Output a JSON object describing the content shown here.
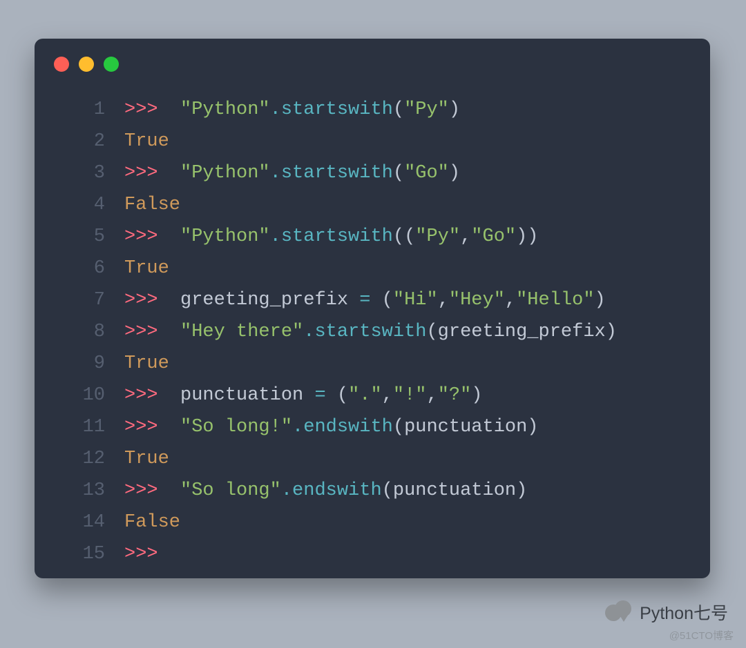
{
  "window": {
    "dots": [
      "red",
      "yellow",
      "green"
    ]
  },
  "code_lines": [
    {
      "n": "1",
      "segments": [
        {
          "cls": "tok-prompt",
          "t": ">>>  "
        },
        {
          "cls": "tok-str",
          "t": "\"Python\""
        },
        {
          "cls": "tok-method",
          "t": ".startswith"
        },
        {
          "cls": "tok-ident",
          "t": "("
        },
        {
          "cls": "tok-str",
          "t": "\"Py\""
        },
        {
          "cls": "tok-ident",
          "t": ")"
        }
      ]
    },
    {
      "n": "2",
      "segments": [
        {
          "cls": "tok-bool",
          "t": "True"
        }
      ]
    },
    {
      "n": "3",
      "segments": [
        {
          "cls": "tok-prompt",
          "t": ">>>  "
        },
        {
          "cls": "tok-str",
          "t": "\"Python\""
        },
        {
          "cls": "tok-method",
          "t": ".startswith"
        },
        {
          "cls": "tok-ident",
          "t": "("
        },
        {
          "cls": "tok-str",
          "t": "\"Go\""
        },
        {
          "cls": "tok-ident",
          "t": ")"
        }
      ]
    },
    {
      "n": "4",
      "segments": [
        {
          "cls": "tok-bool",
          "t": "False"
        }
      ]
    },
    {
      "n": "5",
      "segments": [
        {
          "cls": "tok-prompt",
          "t": ">>>  "
        },
        {
          "cls": "tok-str",
          "t": "\"Python\""
        },
        {
          "cls": "tok-method",
          "t": ".startswith"
        },
        {
          "cls": "tok-ident",
          "t": "(("
        },
        {
          "cls": "tok-str",
          "t": "\"Py\""
        },
        {
          "cls": "tok-ident",
          "t": ","
        },
        {
          "cls": "tok-str",
          "t": "\"Go\""
        },
        {
          "cls": "tok-ident",
          "t": "))"
        }
      ]
    },
    {
      "n": "6",
      "segments": [
        {
          "cls": "tok-bool",
          "t": "True"
        }
      ]
    },
    {
      "n": "7",
      "segments": [
        {
          "cls": "tok-prompt",
          "t": ">>>  "
        },
        {
          "cls": "tok-ident",
          "t": "greeting_prefix "
        },
        {
          "cls": "tok-method",
          "t": "="
        },
        {
          "cls": "tok-ident",
          "t": " ("
        },
        {
          "cls": "tok-str",
          "t": "\"Hi\""
        },
        {
          "cls": "tok-ident",
          "t": ","
        },
        {
          "cls": "tok-str",
          "t": "\"Hey\""
        },
        {
          "cls": "tok-ident",
          "t": ","
        },
        {
          "cls": "tok-str",
          "t": "\"Hello\""
        },
        {
          "cls": "tok-ident",
          "t": ")"
        }
      ]
    },
    {
      "n": "8",
      "segments": [
        {
          "cls": "tok-prompt",
          "t": ">>>  "
        },
        {
          "cls": "tok-str",
          "t": "\"Hey there\""
        },
        {
          "cls": "tok-method",
          "t": ".startswith"
        },
        {
          "cls": "tok-ident",
          "t": "(greeting_prefix)"
        }
      ]
    },
    {
      "n": "9",
      "segments": [
        {
          "cls": "tok-bool",
          "t": "True"
        }
      ]
    },
    {
      "n": "10",
      "segments": [
        {
          "cls": "tok-prompt",
          "t": ">>>  "
        },
        {
          "cls": "tok-ident",
          "t": "punctuation "
        },
        {
          "cls": "tok-method",
          "t": "="
        },
        {
          "cls": "tok-ident",
          "t": " ("
        },
        {
          "cls": "tok-str",
          "t": "\".\""
        },
        {
          "cls": "tok-ident",
          "t": ","
        },
        {
          "cls": "tok-str",
          "t": "\"!\""
        },
        {
          "cls": "tok-ident",
          "t": ","
        },
        {
          "cls": "tok-str",
          "t": "\"?\""
        },
        {
          "cls": "tok-ident",
          "t": ")"
        }
      ]
    },
    {
      "n": "11",
      "segments": [
        {
          "cls": "tok-prompt",
          "t": ">>>  "
        },
        {
          "cls": "tok-str",
          "t": "\"So long!\""
        },
        {
          "cls": "tok-method",
          "t": ".endswith"
        },
        {
          "cls": "tok-ident",
          "t": "(punctuation)"
        }
      ]
    },
    {
      "n": "12",
      "segments": [
        {
          "cls": "tok-bool",
          "t": "True"
        }
      ]
    },
    {
      "n": "13",
      "segments": [
        {
          "cls": "tok-prompt",
          "t": ">>>  "
        },
        {
          "cls": "tok-str",
          "t": "\"So long\""
        },
        {
          "cls": "tok-method",
          "t": ".endswith"
        },
        {
          "cls": "tok-ident",
          "t": "(punctuation)"
        }
      ]
    },
    {
      "n": "14",
      "segments": [
        {
          "cls": "tok-bool",
          "t": "False"
        }
      ]
    },
    {
      "n": "15",
      "segments": [
        {
          "cls": "tok-prompt",
          "t": ">>>"
        }
      ]
    }
  ],
  "brand": {
    "label": "Python七号"
  },
  "watermark": {
    "label": "@51CTO博客"
  }
}
